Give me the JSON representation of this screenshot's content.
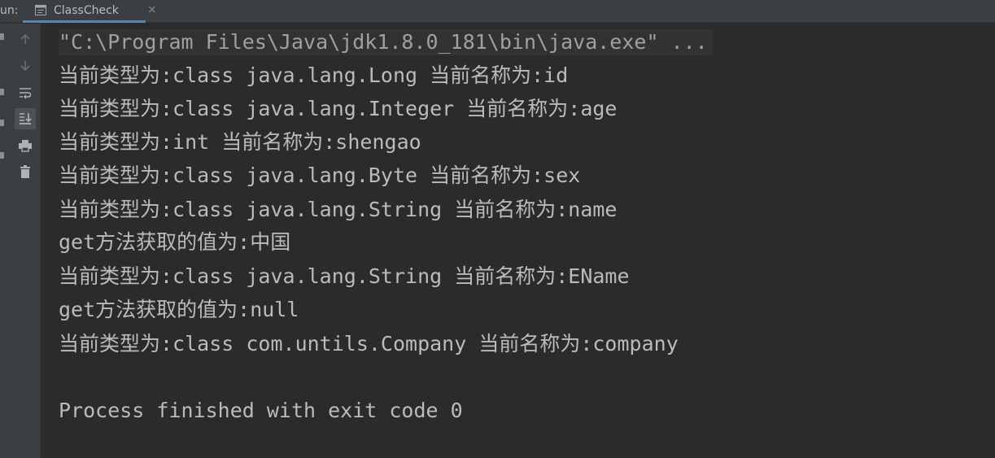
{
  "run": {
    "label": "un:",
    "tab_title": "ClassCheck",
    "tab_close": "×"
  },
  "toolbar": {
    "icons": [
      "up-arrow-icon",
      "down-arrow-icon",
      "soft-wrap-icon",
      "scroll-to-end-icon",
      "print-icon",
      "trash-icon"
    ]
  },
  "console": {
    "command": "\"C:\\Program Files\\Java\\jdk1.8.0_181\\bin\\java.exe\" ...",
    "lines": [
      "当前类型为:class java.lang.Long 当前名称为:id",
      "当前类型为:class java.lang.Integer 当前名称为:age",
      "当前类型为:int 当前名称为:shengao",
      "当前类型为:class java.lang.Byte 当前名称为:sex",
      "当前类型为:class java.lang.String 当前名称为:name",
      "get方法获取的值为:中国",
      "当前类型为:class java.lang.String 当前名称为:EName",
      "get方法获取的值为:null",
      "当前类型为:class com.untils.Company 当前名称为:company"
    ],
    "exit_message": "Process finished with exit code 0"
  },
  "colors": {
    "background": "#2b2b2b",
    "panel": "#3c3f41",
    "text": "#bbbbbb",
    "accent": "#4a88c7"
  }
}
